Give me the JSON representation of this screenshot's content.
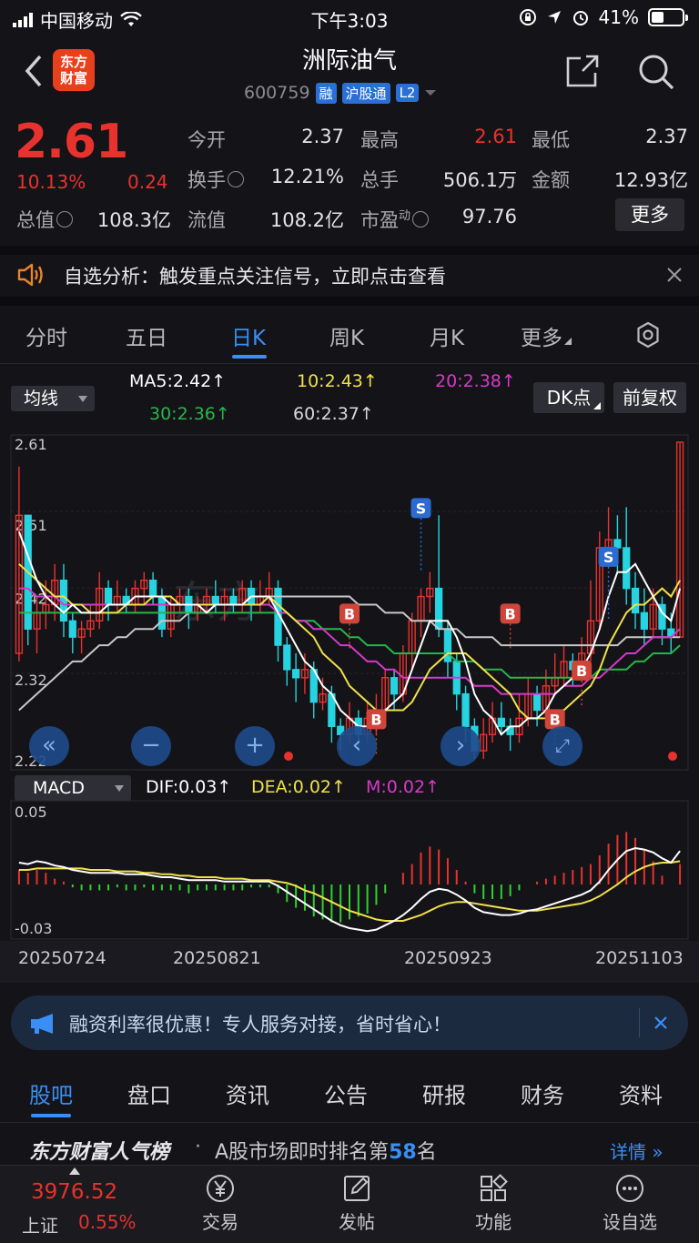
{
  "status_bar": {
    "carrier": "中国移动",
    "time": "下午3:03",
    "battery": "41%",
    "battery_level": 0.41
  },
  "header": {
    "logo_line1": "东方",
    "logo_line2": "财富",
    "stock_name": "洲际油气",
    "stock_code": "600759",
    "tags": [
      "融",
      "沪股通",
      "L2"
    ]
  },
  "quote": {
    "price": "2.61",
    "change_pct": "10.13%",
    "change": "0.24",
    "labels": {
      "open": "今开",
      "high": "最高",
      "low": "最低",
      "turnover": "换手",
      "volume": "总手",
      "amount": "金额",
      "mktcap": "总值",
      "float_cap": "流值",
      "pe": "市盈",
      "pe_sup": "动"
    },
    "values": {
      "open": "2.37",
      "high": "2.61",
      "low": "2.37",
      "turnover": "12.21%",
      "volume": "506.1万",
      "amount": "12.93亿",
      "mktcap": "108.3亿",
      "float_cap": "108.2亿",
      "pe": "97.76"
    },
    "more": "更多"
  },
  "notice": {
    "text": "自选分析：触发重点关注信号，立即点击查看"
  },
  "ktabs": [
    "分时",
    "五日",
    "日K",
    "周K",
    "月K",
    "更多"
  ],
  "ma": {
    "select": "均线",
    "ma5": "MA5:2.42",
    "ma10": "10:2.43",
    "ma20": "20:2.38",
    "ma30": "30:2.36",
    "ma60": "60:2.37",
    "dk": "DK点",
    "adjust": "前复权",
    "arrow": "↑"
  },
  "macd": {
    "select": "MACD",
    "dif": "DIF:0.03",
    "dea": "DEA:0.02",
    "m": "M:0.02",
    "arrow": "↑"
  },
  "colors": {
    "up": "#e8322e",
    "down": "#27d3e0",
    "ma5": "#ffffff",
    "ma10": "#f0e04a",
    "ma20": "#d639c9",
    "ma30": "#28b44a",
    "ma60": "#c8c8c8",
    "accent": "#3a8ef5"
  },
  "chart_data": [
    {
      "type": "candlestick",
      "y_ticks": [
        "2.61",
        "2.51",
        "2.42",
        "2.32",
        "2.22"
      ],
      "ylim": [
        2.22,
        2.61
      ],
      "signals": {
        "buy": "B",
        "sell": "S"
      },
      "candles": [
        [
          2.35,
          2.52,
          2.58,
          2.34
        ],
        [
          2.52,
          2.38,
          2.52,
          2.36
        ],
        [
          2.38,
          2.4,
          2.42,
          2.35
        ],
        [
          2.4,
          2.41,
          2.44,
          2.38
        ],
        [
          2.41,
          2.44,
          2.46,
          2.39
        ],
        [
          2.44,
          2.39,
          2.46,
          2.37
        ],
        [
          2.39,
          2.37,
          2.4,
          2.35
        ],
        [
          2.37,
          2.38,
          2.39,
          2.35
        ],
        [
          2.38,
          2.39,
          2.41,
          2.37
        ],
        [
          2.39,
          2.43,
          2.45,
          2.38
        ],
        [
          2.43,
          2.41,
          2.44,
          2.39
        ],
        [
          2.41,
          2.42,
          2.44,
          2.4
        ],
        [
          2.42,
          2.41,
          2.43,
          2.4
        ],
        [
          2.41,
          2.43,
          2.44,
          2.4
        ],
        [
          2.43,
          2.44,
          2.45,
          2.41
        ],
        [
          2.44,
          2.42,
          2.45,
          2.41
        ],
        [
          2.42,
          2.38,
          2.43,
          2.37
        ],
        [
          2.38,
          2.41,
          2.42,
          2.37
        ],
        [
          2.41,
          2.42,
          2.43,
          2.4
        ],
        [
          2.42,
          2.4,
          2.43,
          2.38
        ],
        [
          2.4,
          2.41,
          2.42,
          2.39
        ],
        [
          2.41,
          2.42,
          2.43,
          2.4
        ],
        [
          2.42,
          2.41,
          2.44,
          2.4
        ],
        [
          2.41,
          2.42,
          2.43,
          2.39
        ],
        [
          2.42,
          2.41,
          2.43,
          2.4
        ],
        [
          2.41,
          2.43,
          2.44,
          2.4
        ],
        [
          2.43,
          2.41,
          2.44,
          2.39
        ],
        [
          2.41,
          2.42,
          2.44,
          2.4
        ],
        [
          2.42,
          2.43,
          2.45,
          2.41
        ],
        [
          2.43,
          2.36,
          2.44,
          2.34
        ],
        [
          2.36,
          2.33,
          2.37,
          2.31
        ],
        [
          2.33,
          2.32,
          2.35,
          2.29
        ],
        [
          2.32,
          2.33,
          2.35,
          2.3
        ],
        [
          2.33,
          2.29,
          2.34,
          2.27
        ],
        [
          2.29,
          2.3,
          2.32,
          2.28
        ],
        [
          2.3,
          2.26,
          2.31,
          2.24
        ],
        [
          2.26,
          2.25,
          2.27,
          2.23
        ],
        [
          2.25,
          2.27,
          2.29,
          2.24
        ],
        [
          2.27,
          2.25,
          2.28,
          2.23
        ],
        [
          2.25,
          2.27,
          2.29,
          2.24
        ],
        [
          2.27,
          2.28,
          2.3,
          2.25
        ],
        [
          2.28,
          2.32,
          2.33,
          2.27
        ],
        [
          2.32,
          2.3,
          2.33,
          2.28
        ],
        [
          2.3,
          2.35,
          2.36,
          2.29
        ],
        [
          2.35,
          2.39,
          2.4,
          2.33
        ],
        [
          2.39,
          2.42,
          2.43,
          2.37
        ],
        [
          2.42,
          2.43,
          2.45,
          2.4
        ],
        [
          2.43,
          2.38,
          2.52,
          2.37
        ],
        [
          2.38,
          2.34,
          2.39,
          2.32
        ],
        [
          2.34,
          2.3,
          2.35,
          2.28
        ],
        [
          2.3,
          2.26,
          2.31,
          2.24
        ],
        [
          2.26,
          2.23,
          2.27,
          2.22
        ],
        [
          2.23,
          2.25,
          2.27,
          2.22
        ],
        [
          2.25,
          2.27,
          2.29,
          2.24
        ],
        [
          2.27,
          2.26,
          2.29,
          2.25
        ],
        [
          2.26,
          2.25,
          2.27,
          2.23
        ],
        [
          2.25,
          2.27,
          2.3,
          2.24
        ],
        [
          2.27,
          2.3,
          2.32,
          2.26
        ],
        [
          2.3,
          2.28,
          2.31,
          2.26
        ],
        [
          2.28,
          2.31,
          2.33,
          2.27
        ],
        [
          2.31,
          2.32,
          2.35,
          2.3
        ],
        [
          2.32,
          2.34,
          2.36,
          2.31
        ],
        [
          2.34,
          2.33,
          2.35,
          2.31
        ],
        [
          2.33,
          2.35,
          2.37,
          2.32
        ],
        [
          2.35,
          2.39,
          2.44,
          2.34
        ],
        [
          2.39,
          2.48,
          2.5,
          2.38
        ],
        [
          2.48,
          2.49,
          2.53,
          2.46
        ],
        [
          2.49,
          2.48,
          2.52,
          2.45
        ],
        [
          2.48,
          2.43,
          2.53,
          2.41
        ],
        [
          2.43,
          2.4,
          2.45,
          2.38
        ],
        [
          2.4,
          2.38,
          2.43,
          2.36
        ],
        [
          2.38,
          2.41,
          2.43,
          2.37
        ],
        [
          2.41,
          2.38,
          2.42,
          2.36
        ],
        [
          2.38,
          2.37,
          2.4,
          2.35
        ],
        [
          2.37,
          2.61,
          2.61,
          2.37
        ]
      ],
      "ma5": [
        2.5,
        2.47,
        2.44,
        2.42,
        2.41,
        2.4,
        2.41,
        2.4,
        2.4,
        2.4,
        2.41,
        2.41,
        2.41,
        2.42,
        2.42,
        2.42,
        2.42,
        2.41,
        2.41,
        2.41,
        2.41,
        2.4,
        2.41,
        2.41,
        2.41,
        2.41,
        2.42,
        2.42,
        2.42,
        2.4,
        2.38,
        2.36,
        2.34,
        2.33,
        2.31,
        2.3,
        2.28,
        2.27,
        2.26,
        2.26,
        2.26,
        2.28,
        2.29,
        2.3,
        2.33,
        2.36,
        2.39,
        2.39,
        2.39,
        2.37,
        2.34,
        2.3,
        2.28,
        2.27,
        2.25,
        2.26,
        2.26,
        2.27,
        2.27,
        2.28,
        2.3,
        2.31,
        2.32,
        2.33,
        2.35,
        2.38,
        2.42,
        2.45,
        2.45,
        2.46,
        2.44,
        2.42,
        2.4,
        2.39,
        2.43
      ],
      "ma10": [
        2.46,
        2.45,
        2.44,
        2.43,
        2.42,
        2.42,
        2.41,
        2.41,
        2.4,
        2.4,
        2.4,
        2.4,
        2.41,
        2.41,
        2.41,
        2.42,
        2.42,
        2.42,
        2.41,
        2.41,
        2.41,
        2.41,
        2.41,
        2.41,
        2.41,
        2.41,
        2.41,
        2.41,
        2.42,
        2.41,
        2.4,
        2.39,
        2.38,
        2.37,
        2.35,
        2.34,
        2.33,
        2.31,
        2.3,
        2.29,
        2.28,
        2.28,
        2.28,
        2.28,
        2.29,
        2.31,
        2.33,
        2.34,
        2.35,
        2.35,
        2.35,
        2.34,
        2.33,
        2.32,
        2.31,
        2.3,
        2.28,
        2.27,
        2.27,
        2.27,
        2.28,
        2.28,
        2.29,
        2.3,
        2.31,
        2.33,
        2.36,
        2.38,
        2.4,
        2.41,
        2.41,
        2.42,
        2.43,
        2.42,
        2.44
      ],
      "ma20": [
        2.43,
        2.43,
        2.42,
        2.42,
        2.42,
        2.41,
        2.41,
        2.41,
        2.41,
        2.41,
        2.41,
        2.41,
        2.41,
        2.41,
        2.41,
        2.41,
        2.41,
        2.41,
        2.41,
        2.41,
        2.41,
        2.41,
        2.41,
        2.41,
        2.41,
        2.41,
        2.41,
        2.41,
        2.41,
        2.4,
        2.4,
        2.39,
        2.39,
        2.38,
        2.38,
        2.37,
        2.36,
        2.36,
        2.35,
        2.34,
        2.34,
        2.33,
        2.33,
        2.32,
        2.32,
        2.32,
        2.32,
        2.32,
        2.32,
        2.32,
        2.32,
        2.31,
        2.31,
        2.31,
        2.3,
        2.3,
        2.3,
        2.3,
        2.3,
        2.3,
        2.3,
        2.31,
        2.31,
        2.31,
        2.32,
        2.32,
        2.33,
        2.34,
        2.35,
        2.35,
        2.36,
        2.37,
        2.37,
        2.37,
        2.38
      ],
      "ma30": [
        2.4,
        2.4,
        2.4,
        2.4,
        2.4,
        2.4,
        2.4,
        2.4,
        2.4,
        2.4,
        2.4,
        2.4,
        2.4,
        2.4,
        2.4,
        2.4,
        2.4,
        2.4,
        2.4,
        2.4,
        2.4,
        2.4,
        2.4,
        2.4,
        2.4,
        2.4,
        2.4,
        2.4,
        2.4,
        2.4,
        2.4,
        2.39,
        2.39,
        2.39,
        2.38,
        2.38,
        2.38,
        2.37,
        2.37,
        2.36,
        2.36,
        2.36,
        2.35,
        2.35,
        2.35,
        2.35,
        2.35,
        2.35,
        2.35,
        2.34,
        2.34,
        2.34,
        2.33,
        2.33,
        2.33,
        2.32,
        2.32,
        2.32,
        2.32,
        2.32,
        2.32,
        2.32,
        2.32,
        2.32,
        2.32,
        2.33,
        2.33,
        2.33,
        2.33,
        2.34,
        2.34,
        2.35,
        2.35,
        2.35,
        2.36
      ],
      "ma60": [
        2.28,
        2.29,
        2.3,
        2.31,
        2.32,
        2.33,
        2.34,
        2.34,
        2.35,
        2.36,
        2.36,
        2.37,
        2.37,
        2.38,
        2.38,
        2.38,
        2.39,
        2.39,
        2.39,
        2.4,
        2.4,
        2.4,
        2.41,
        2.41,
        2.41,
        2.41,
        2.42,
        2.42,
        2.42,
        2.42,
        2.42,
        2.42,
        2.42,
        2.42,
        2.42,
        2.42,
        2.42,
        2.42,
        2.41,
        2.41,
        2.41,
        2.4,
        2.4,
        2.4,
        2.39,
        2.39,
        2.39,
        2.38,
        2.38,
        2.38,
        2.37,
        2.37,
        2.37,
        2.37,
        2.36,
        2.36,
        2.36,
        2.36,
        2.36,
        2.36,
        2.36,
        2.36,
        2.36,
        2.36,
        2.36,
        2.36,
        2.36,
        2.36,
        2.37,
        2.37,
        2.37,
        2.37,
        2.37,
        2.37,
        2.37
      ]
    },
    {
      "type": "macd",
      "y_ticks": [
        "0.05",
        "-0.03"
      ],
      "ylim": [
        -0.035,
        0.055
      ],
      "x_ticks": [
        "20250724",
        "20250821",
        "20250923",
        "20251103"
      ],
      "dif": [
        0.015,
        0.014,
        0.016,
        0.015,
        0.013,
        0.012,
        0.01,
        0.009,
        0.008,
        0.008,
        0.008,
        0.008,
        0.007,
        0.007,
        0.007,
        0.006,
        0.005,
        0.005,
        0.004,
        0.003,
        0.003,
        0.003,
        0.003,
        0.002,
        0.002,
        0.002,
        0.002,
        0.002,
        0.002,
        -0.001,
        -0.005,
        -0.009,
        -0.013,
        -0.017,
        -0.021,
        -0.025,
        -0.028,
        -0.03,
        -0.031,
        -0.032,
        -0.031,
        -0.028,
        -0.025,
        -0.021,
        -0.016,
        -0.01,
        -0.005,
        -0.003,
        -0.004,
        -0.007,
        -0.011,
        -0.016,
        -0.019,
        -0.02,
        -0.021,
        -0.021,
        -0.02,
        -0.018,
        -0.017,
        -0.015,
        -0.013,
        -0.011,
        -0.009,
        -0.007,
        -0.004,
        0.002,
        0.01,
        0.017,
        0.023,
        0.025,
        0.024,
        0.022,
        0.018,
        0.015,
        0.023
      ],
      "dea": [
        0.01,
        0.01,
        0.011,
        0.011,
        0.011,
        0.011,
        0.011,
        0.011,
        0.01,
        0.01,
        0.01,
        0.009,
        0.009,
        0.009,
        0.008,
        0.008,
        0.007,
        0.007,
        0.006,
        0.006,
        0.005,
        0.005,
        0.005,
        0.004,
        0.004,
        0.004,
        0.003,
        0.003,
        0.003,
        0.002,
        0.001,
        -0.001,
        -0.004,
        -0.006,
        -0.009,
        -0.012,
        -0.015,
        -0.018,
        -0.02,
        -0.022,
        -0.024,
        -0.025,
        -0.025,
        -0.025,
        -0.023,
        -0.021,
        -0.018,
        -0.015,
        -0.013,
        -0.012,
        -0.012,
        -0.013,
        -0.014,
        -0.015,
        -0.016,
        -0.017,
        -0.018,
        -0.018,
        -0.018,
        -0.017,
        -0.016,
        -0.015,
        -0.014,
        -0.013,
        -0.011,
        -0.008,
        -0.004,
        0.0,
        0.005,
        0.009,
        0.012,
        0.014,
        0.015,
        0.015,
        0.016
      ],
      "macd": [
        0.01,
        0.008,
        0.01,
        0.008,
        0.004,
        0.002,
        -0.002,
        -0.004,
        -0.004,
        -0.004,
        -0.004,
        -0.002,
        -0.004,
        -0.004,
        -0.002,
        -0.004,
        -0.004,
        -0.004,
        -0.004,
        -0.006,
        -0.004,
        -0.004,
        -0.004,
        -0.004,
        -0.004,
        -0.004,
        -0.002,
        -0.002,
        -0.002,
        -0.006,
        -0.012,
        -0.016,
        -0.018,
        -0.022,
        -0.024,
        -0.026,
        -0.026,
        -0.024,
        -0.022,
        -0.02,
        -0.014,
        -0.006,
        0.0,
        0.008,
        0.014,
        0.022,
        0.026,
        0.024,
        0.018,
        0.01,
        0.002,
        -0.006,
        -0.01,
        -0.01,
        -0.01,
        -0.008,
        -0.004,
        0.0,
        0.002,
        0.004,
        0.006,
        0.008,
        0.01,
        0.012,
        0.014,
        0.02,
        0.028,
        0.034,
        0.036,
        0.032,
        0.024,
        0.016,
        0.006,
        0.0,
        0.014
      ]
    }
  ],
  "dates": [
    "20250724",
    "20250821",
    "20250923",
    "20251103"
  ],
  "promo": {
    "text": "融资利率很优惠！专人服务对接，省时省心！"
  },
  "btabs": [
    "股吧",
    "盘口",
    "资讯",
    "公告",
    "研报",
    "财务",
    "资料"
  ],
  "rank": {
    "brand": "东方财富人气榜",
    "sep": "·",
    "text_before": "A股市场即时排名第",
    "rank": "58",
    "text_after": "名",
    "detail": "详情"
  },
  "bottom_nav": {
    "index_value": "3976.52",
    "index_name": "上证",
    "index_change": "0.55%",
    "items": [
      "交易",
      "发帖",
      "功能",
      "设自选"
    ]
  }
}
